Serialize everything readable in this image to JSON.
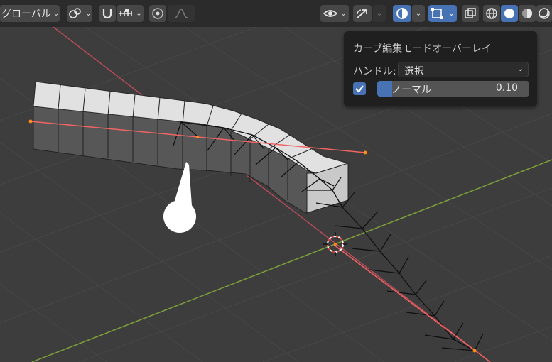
{
  "toolbar": {
    "orientation_label": "グローバル",
    "pivot_icon": "pivot-icon",
    "snap_icon": "magnet-icon",
    "snap_target_icon": "snap-increment-icon",
    "proportional_icon": "proportional-edit-icon",
    "falloff_icon": "falloff-curve-icon",
    "visibility_icon": "eye-icon",
    "gizmo_icon": "gizmo-icon",
    "overlay_icon": "overlay-icon",
    "edit_overlay_icon": "curve-edit-overlay-icon",
    "xray_icon": "xray-icon",
    "shading_modes": [
      "wireframe",
      "solid",
      "material-preview",
      "rendered"
    ],
    "active_shading": "solid"
  },
  "popover": {
    "title": "カーブ編集モードオーバーレイ",
    "handle_label": "ハンドル:",
    "handle_value": "選択",
    "normal_checked": true,
    "normal_label": "ノーマル",
    "normal_value": "0.10",
    "normal_fraction": 0.1
  },
  "colors": {
    "accent": "#4772b3",
    "viewport_bg": "#3d3d3d",
    "x_axis": "#b44b5a",
    "y_axis": "#7ea03a",
    "curve_line": "#f06464",
    "handle_point": "#ff8c1a"
  }
}
